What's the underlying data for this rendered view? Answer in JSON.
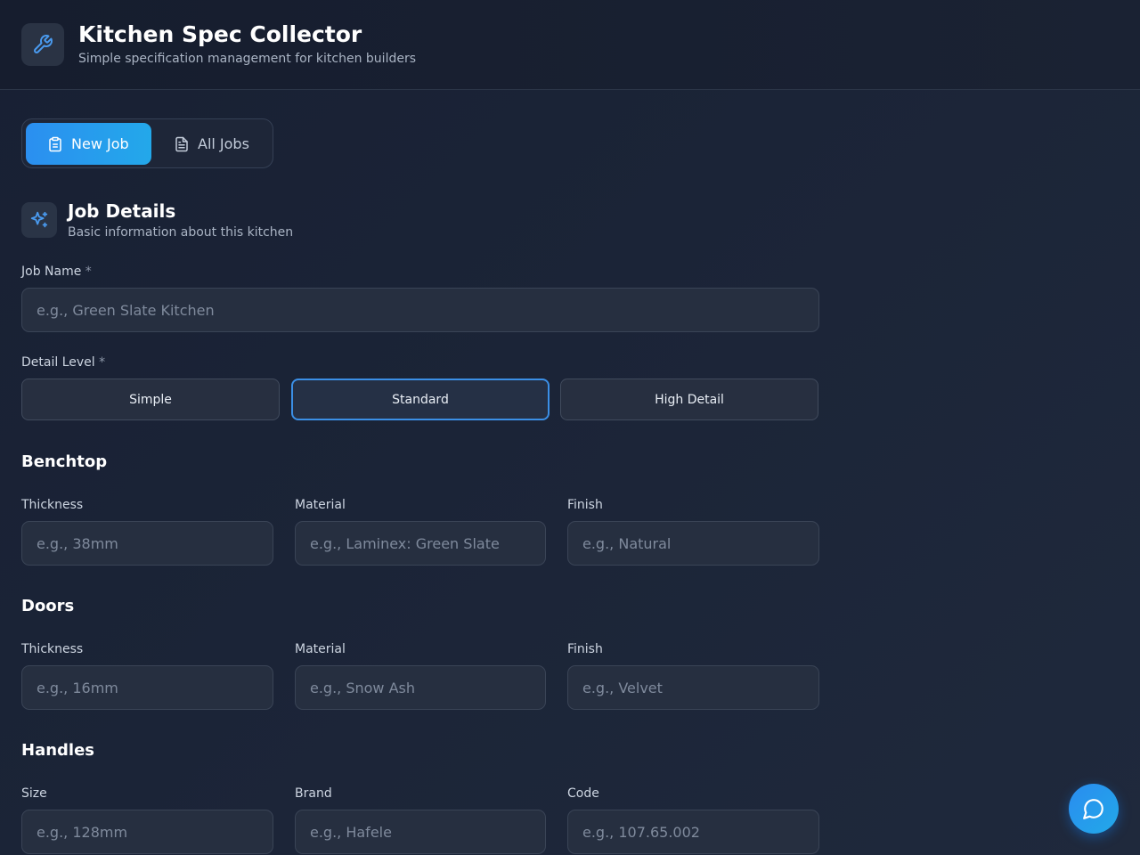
{
  "header": {
    "title": "Kitchen Spec Collector",
    "subtitle": "Simple specification management for kitchen builders",
    "icon": "wrench-icon"
  },
  "tabs": [
    {
      "label": "New Job",
      "icon": "clipboard-icon",
      "active": true
    },
    {
      "label": "All Jobs",
      "icon": "document-icon",
      "active": false
    }
  ],
  "job_details": {
    "title": "Job Details",
    "subtitle": "Basic information about this kitchen",
    "icon": "sparkles-icon",
    "job_name_label": "Job Name",
    "job_name_placeholder": "e.g., Green Slate Kitchen",
    "job_name_value": "",
    "detail_level_label": "Detail Level",
    "required_mark": "*",
    "detail_levels": [
      "Simple",
      "Standard",
      "High Detail"
    ],
    "selected_detail_level": "Standard"
  },
  "benchtop": {
    "title": "Benchtop",
    "fields": [
      {
        "label": "Thickness",
        "placeholder": "e.g., 38mm",
        "value": ""
      },
      {
        "label": "Material",
        "placeholder": "e.g., Laminex: Green Slate",
        "value": ""
      },
      {
        "label": "Finish",
        "placeholder": "e.g., Natural",
        "value": ""
      }
    ]
  },
  "doors": {
    "title": "Doors",
    "fields": [
      {
        "label": "Thickness",
        "placeholder": "e.g., 16mm",
        "value": ""
      },
      {
        "label": "Material",
        "placeholder": "e.g., Snow Ash",
        "value": ""
      },
      {
        "label": "Finish",
        "placeholder": "e.g., Velvet",
        "value": ""
      }
    ]
  },
  "handles": {
    "title": "Handles",
    "fields": [
      {
        "label": "Size",
        "placeholder": "e.g., 128mm",
        "value": ""
      },
      {
        "label": "Brand",
        "placeholder": "e.g., Hafele",
        "value": ""
      },
      {
        "label": "Code",
        "placeholder": "e.g., 107.65.002",
        "value": ""
      }
    ]
  },
  "chat": {
    "icon": "chat-bubble-icon"
  },
  "colors": {
    "accent": "#2b8ff0",
    "background": "#1b2437",
    "input_bg": "#262f40",
    "icon_blue": "#4a9bf0"
  }
}
